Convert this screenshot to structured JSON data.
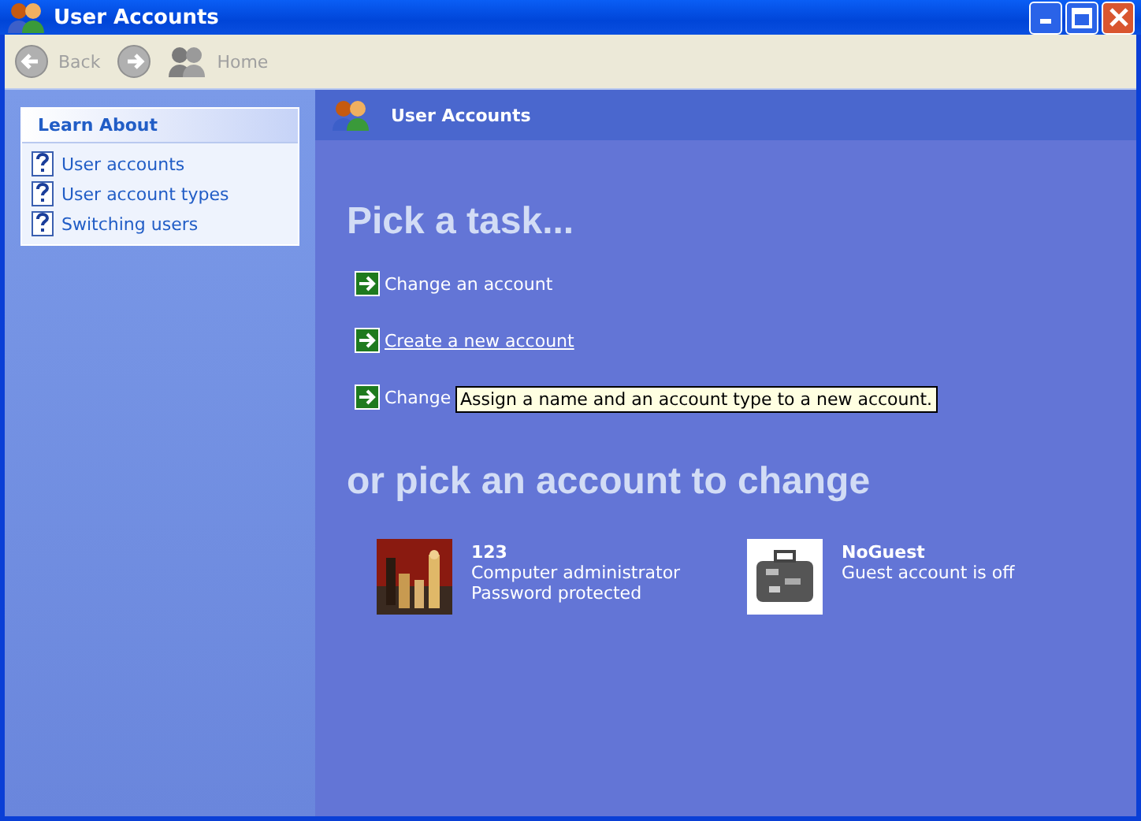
{
  "window": {
    "title": "User Accounts"
  },
  "toolbar": {
    "buttons": [
      {
        "kind": "back",
        "label": "Back",
        "disabled": true
      },
      {
        "kind": "forward",
        "disabled": true
      },
      {
        "kind": "home",
        "label": "Home",
        "disabled": true
      }
    ]
  },
  "sidebar": {
    "title": "Learn About",
    "items": [
      {
        "label": "User accounts"
      },
      {
        "label": "User account types"
      },
      {
        "label": "Switching users"
      }
    ]
  },
  "main": {
    "header": "User Accounts",
    "task_heading": "Pick a task...",
    "tasks": [
      {
        "label": "Change an account",
        "hovered": false
      },
      {
        "label": "Create a new account",
        "hovered": true
      },
      {
        "label": "Change",
        "hovered": false
      }
    ],
    "tooltip": "Assign a name and an account type to a new account.",
    "account_heading": "or pick an account to change",
    "accounts": [
      {
        "name": "123",
        "lines": [
          "Computer administrator",
          "Password protected"
        ],
        "kind": "picture"
      },
      {
        "name": "NoGuest",
        "lines": [
          "Guest account is off"
        ],
        "kind": "picture"
      }
    ]
  }
}
